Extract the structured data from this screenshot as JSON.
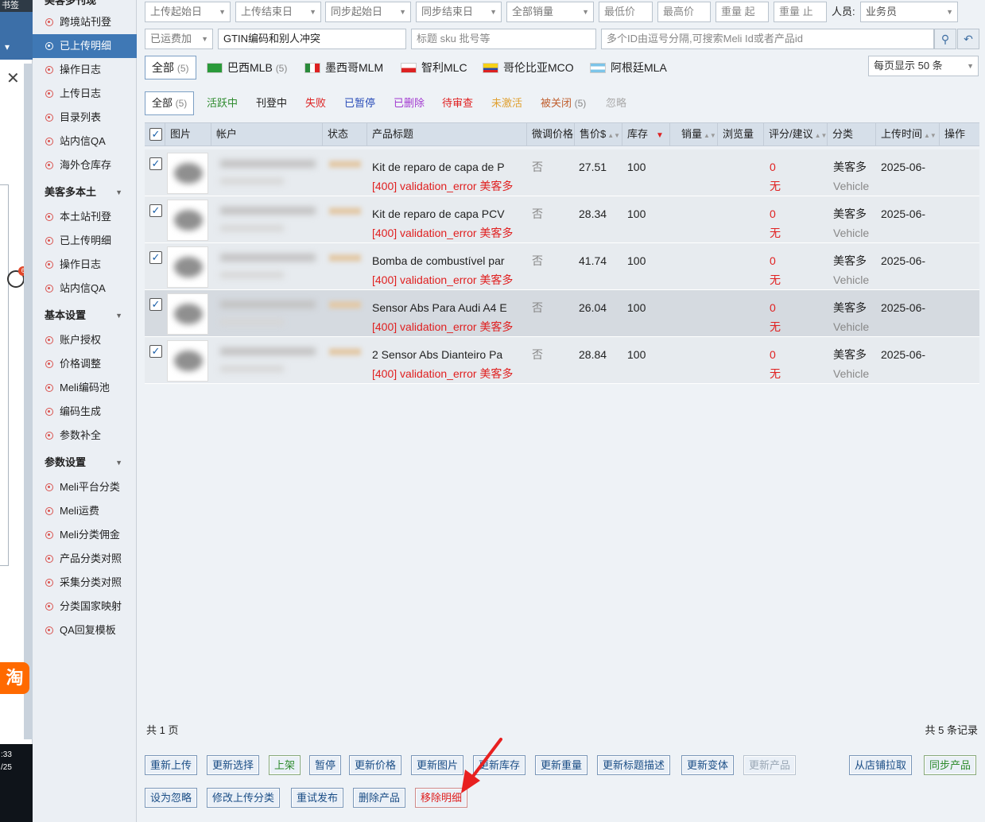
{
  "leftstrip": {
    "top_text": "书签",
    "clock_time": ":33",
    "clock_date": "/25",
    "badge": "6",
    "tao": "淘"
  },
  "nav": {
    "top_title": "美客多刊现",
    "items1": [
      "跨境站刊登",
      "已上传明细",
      "操作日志",
      "上传日志",
      "目录列表",
      "站内信QA",
      "海外仓库存"
    ],
    "head2": "美客多本土",
    "items2": [
      "本土站刊登",
      "已上传明细",
      "操作日志",
      "站内信QA"
    ],
    "head3": "基本设置",
    "items3": [
      "账户授权",
      "价格调整",
      "Meli编码池",
      "编码生成",
      "参数补全"
    ],
    "head4": "参数设置",
    "items4": [
      "Meli平台分类",
      "Meli运费",
      "Meli分类佣金",
      "产品分类对照",
      "采集分类对照",
      "分类国家映射",
      "QA回复模板"
    ]
  },
  "filters": {
    "upload_start": "上传起始日",
    "upload_end": "上传结束日",
    "sync_start": "同步起始日",
    "sync_end": "同步结束日",
    "sales": "全部销量",
    "min_price": "最低价",
    "max_price": "最高价",
    "weight_from": "重量 起",
    "weight_to": "重量 止",
    "person_label": "人员:",
    "person_value": "业务员",
    "shipping": "已运费加",
    "gtin_value": "GTIN编码和别人冲突",
    "title_placeholder": "标题 sku 批号等",
    "ids_placeholder": "多个ID由逗号分隔,可搜索Meli Id或者产品id"
  },
  "sites": {
    "all": "全部",
    "all_count": "(5)",
    "brazil": "巴西MLB",
    "brazil_count": "(5)",
    "mexico": "墨西哥MLM",
    "chile": "智利MLC",
    "colombia": "哥伦比亚MCO",
    "argentina": "阿根廷MLA",
    "page_size": "每页显示 50 条"
  },
  "status_tabs": {
    "all": "全部",
    "all_count": "(5)",
    "active": "活跃中",
    "listing": "刊登中",
    "failed": "失败",
    "paused": "已暂停",
    "deleted": "已删除",
    "review": "待审查",
    "inactive": "未激活",
    "closed": "被关闭",
    "closed_count": "(5)",
    "ignored": "忽略"
  },
  "columns": {
    "image": "图片",
    "account": "帐户",
    "status": "状态",
    "title": "产品标题",
    "adjust": "微调价格",
    "price": "售价$",
    "stock": "库存",
    "sales": "销量",
    "views": "浏览量",
    "rating": "评分/建议",
    "category": "分类",
    "upload_time": "上传时间",
    "action": "操作"
  },
  "rows": [
    {
      "title": "Kit de reparo de capa de P",
      "error": "[400] validation_error 美客多",
      "adjust": "否",
      "price": "27.51",
      "stock": "100",
      "rating": "0",
      "rating2": "无",
      "cat": "美客多",
      "cat2": "Vehicle",
      "time": "2025-06-"
    },
    {
      "title": "Kit de reparo de capa PCV",
      "error": "[400] validation_error 美客多",
      "adjust": "否",
      "price": "28.34",
      "stock": "100",
      "rating": "0",
      "rating2": "无",
      "cat": "美客多",
      "cat2": "Vehicle",
      "time": "2025-06-"
    },
    {
      "title": "Bomba de combustível par",
      "error": "[400] validation_error 美客多",
      "adjust": "否",
      "price": "41.74",
      "stock": "100",
      "rating": "0",
      "rating2": "无",
      "cat": "美客多",
      "cat2": "Vehicle",
      "time": "2025-06-"
    },
    {
      "title": "Sensor Abs Para Audi A4 E",
      "error": "[400] validation_error 美客多",
      "adjust": "否",
      "price": "26.04",
      "stock": "100",
      "rating": "0",
      "rating2": "无",
      "cat": "美客多",
      "cat2": "Vehicle",
      "time": "2025-06-"
    },
    {
      "title": "2 Sensor Abs Dianteiro Pa",
      "error": "[400] validation_error 美客多",
      "adjust": "否",
      "price": "28.84",
      "stock": "100",
      "rating": "0",
      "rating2": "无",
      "cat": "美客多",
      "cat2": "Vehicle",
      "time": "2025-06-"
    }
  ],
  "pager": {
    "pages": "共 1 页",
    "records": "共 5 条记录"
  },
  "actions1": [
    "重新上传",
    "更新选择",
    "上架",
    "暂停",
    "更新价格",
    "更新图片",
    "更新库存",
    "更新重量",
    "更新标题描述",
    "更新变体",
    "更新产品"
  ],
  "actions_right": [
    "从店铺拉取",
    "同步产品"
  ],
  "actions2": [
    "设为忽略",
    "修改上传分类",
    "重试发布",
    "删除产品",
    "移除明细"
  ],
  "colors": {
    "accent": "#3f78b5",
    "error": "#e02020",
    "arrow": "#e02020"
  }
}
